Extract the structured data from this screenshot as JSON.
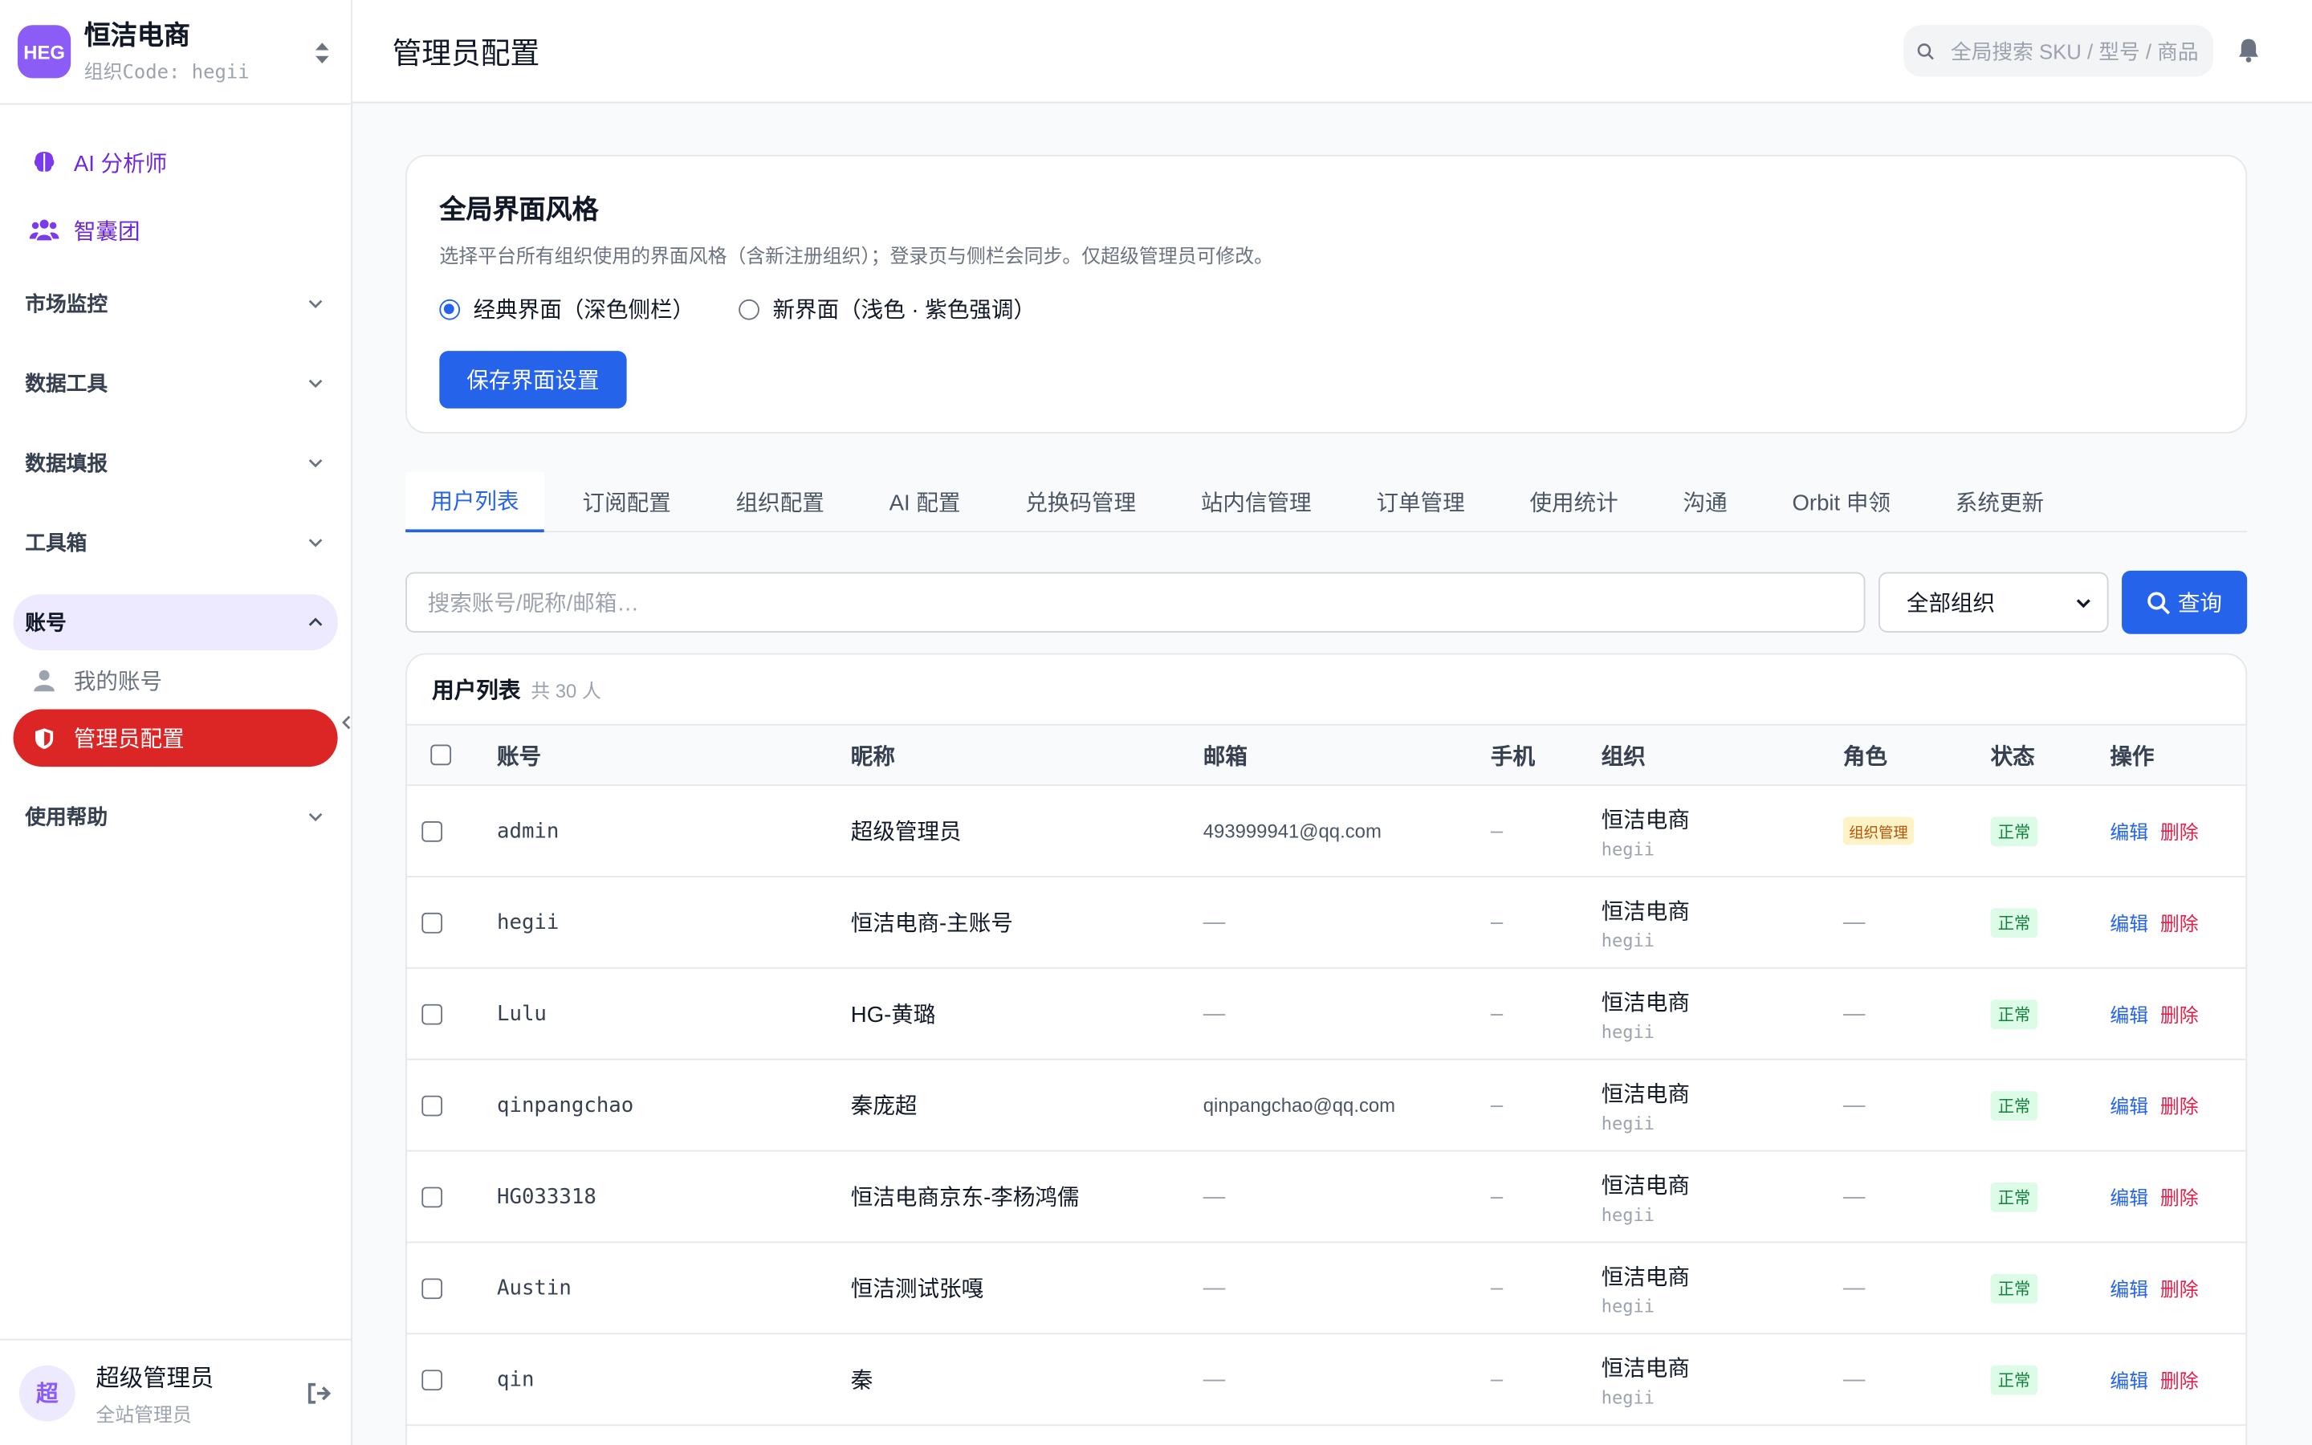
{
  "org": {
    "logo": "HEG",
    "name": "恒洁电商",
    "code": "组织Code: hegii"
  },
  "nav": {
    "ai": "AI 分析师",
    "think": "智囊团",
    "groups": [
      "市场监控",
      "数据工具",
      "数据填报",
      "工具箱"
    ],
    "account": "账号",
    "my_account": "我的账号",
    "admin_config": "管理员配置",
    "help": "使用帮助"
  },
  "footer": {
    "avatar": "超",
    "name": "超级管理员",
    "role": "全站管理员"
  },
  "topbar": {
    "title": "管理员配置",
    "search_placeholder": "全局搜索 SKU / 型号 / 商品"
  },
  "style_card": {
    "title": "全局界面风格",
    "desc": "选择平台所有组织使用的界面风格（含新注册组织）；登录页与侧栏会同步。仅超级管理员可修改。",
    "opt1": "经典界面（深色侧栏）",
    "opt2": "新界面（浅色 · 紫色强调）",
    "save": "保存界面设置"
  },
  "tabs": [
    "用户列表",
    "订阅配置",
    "组织配置",
    "AI 配置",
    "兑换码管理",
    "站内信管理",
    "订单管理",
    "使用统计",
    "沟通",
    "Orbit 申领",
    "系统更新"
  ],
  "filter": {
    "placeholder": "搜索账号/昵称/邮箱…",
    "org": "全部组织",
    "query": "查询"
  },
  "table": {
    "title": "用户列表",
    "count": "共 30 人",
    "headers": {
      "account": "账号",
      "nick": "昵称",
      "email": "邮箱",
      "phone": "手机",
      "org": "组织",
      "role": "角色",
      "status": "状态",
      "op": "操作"
    },
    "rows": [
      {
        "account": "admin",
        "nick": "超级管理员",
        "email": "493999941@qq.com",
        "phone": "–",
        "org": "恒洁电商",
        "org_code": "hegii",
        "role": "组织管理",
        "status": "正常"
      },
      {
        "account": "hegii",
        "nick": "恒洁电商-主账号",
        "email": "—",
        "phone": "–",
        "org": "恒洁电商",
        "org_code": "hegii",
        "role": "—",
        "status": "正常"
      },
      {
        "account": "Lulu",
        "nick": "HG-黄璐",
        "email": "—",
        "phone": "–",
        "org": "恒洁电商",
        "org_code": "hegii",
        "role": "—",
        "status": "正常"
      },
      {
        "account": "qinpangchao",
        "nick": "秦庞超",
        "email": "qinpangchao@qq.com",
        "phone": "–",
        "org": "恒洁电商",
        "org_code": "hegii",
        "role": "—",
        "status": "正常"
      },
      {
        "account": "HG033318",
        "nick": "恒洁电商京东-李杨鸿儒",
        "email": "—",
        "phone": "–",
        "org": "恒洁电商",
        "org_code": "hegii",
        "role": "—",
        "status": "正常"
      },
      {
        "account": "Austin",
        "nick": "恒洁测试张嘎",
        "email": "—",
        "phone": "–",
        "org": "恒洁电商",
        "org_code": "hegii",
        "role": "—",
        "status": "正常"
      },
      {
        "account": "qin",
        "nick": "秦",
        "email": "—",
        "phone": "–",
        "org": "恒洁电商",
        "org_code": "hegii",
        "role": "—",
        "status": "正常"
      }
    ],
    "edit": "编辑",
    "delete": "删除"
  }
}
